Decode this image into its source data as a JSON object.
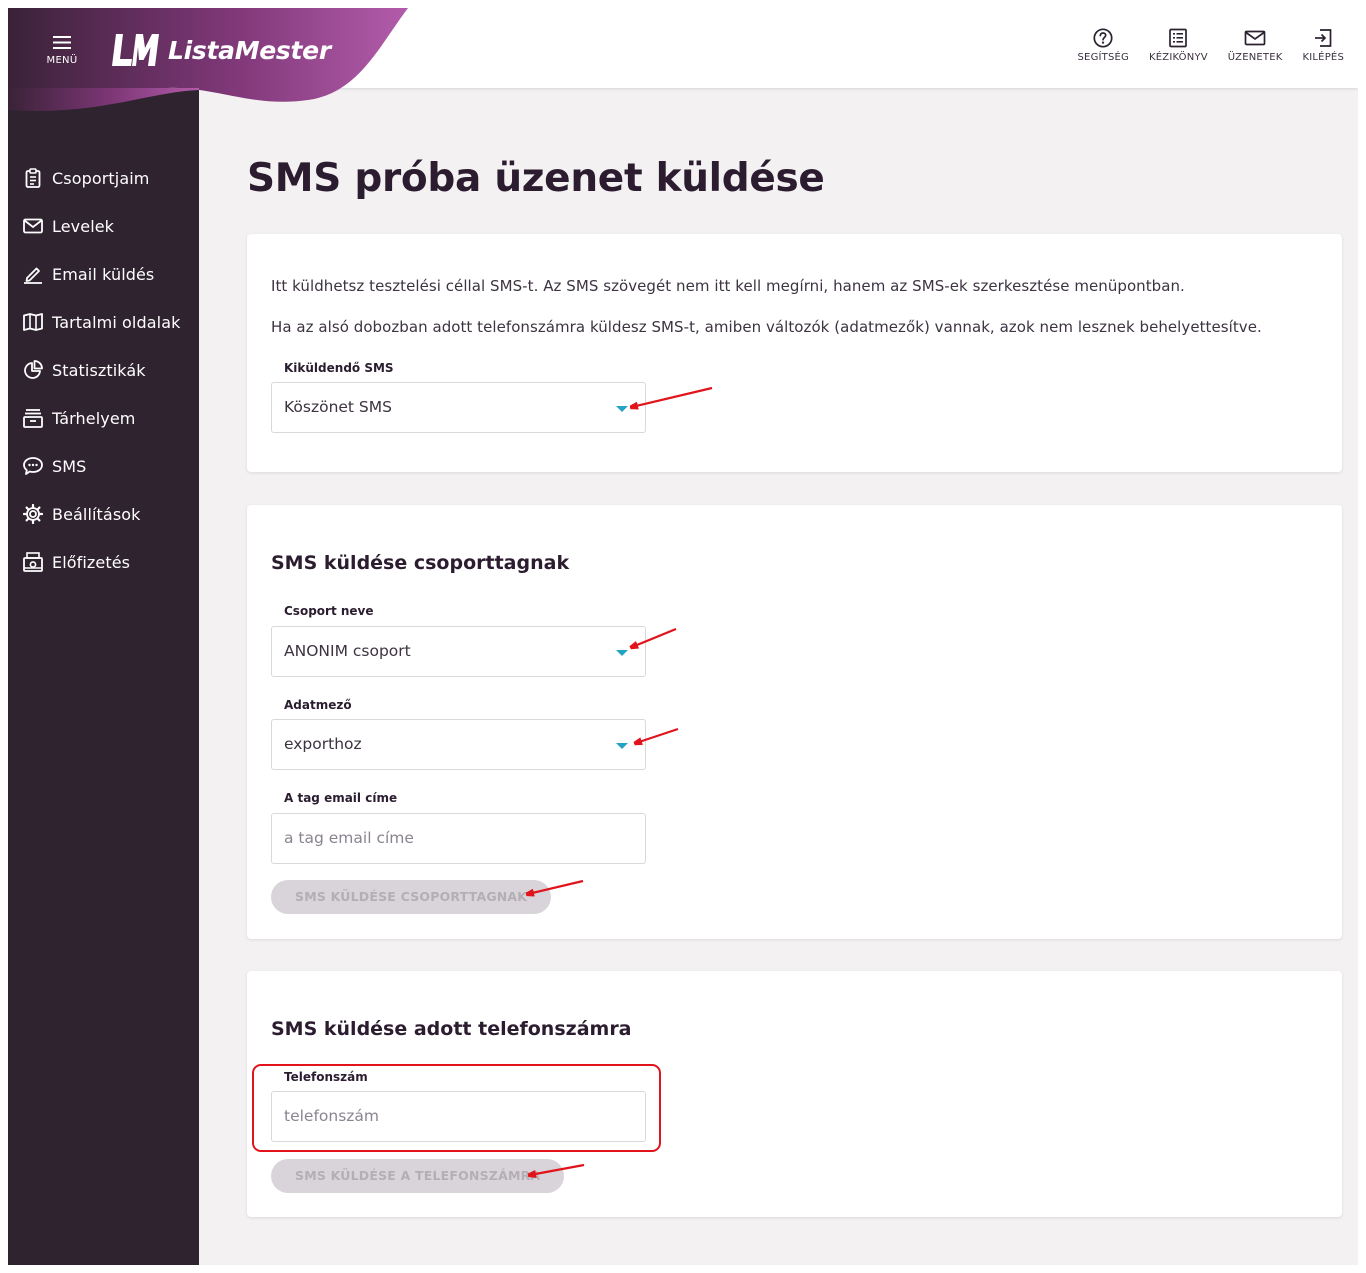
{
  "header": {
    "menu_label": "MENÜ",
    "brand": "ListaMester",
    "brand_gradient": [
      "#2f2330",
      "#8a3d86",
      "#b05aa8"
    ],
    "top_nav": [
      {
        "label": "SEGÍTSÉG",
        "icon": "help-circle-icon"
      },
      {
        "label": "KÉZIKÖNYV",
        "icon": "manual-list-icon"
      },
      {
        "label": "ÜZENETEK",
        "icon": "envelope-icon"
      },
      {
        "label": "KILÉPÉS",
        "icon": "logout-icon"
      }
    ]
  },
  "sidebar": {
    "items": [
      {
        "label": "Csoportjaim",
        "icon": "clipboard-icon"
      },
      {
        "label": "Levelek",
        "icon": "mail-icon"
      },
      {
        "label": "Email küldés",
        "icon": "pen-icon"
      },
      {
        "label": "Tartalmi oldalak",
        "icon": "book-icon"
      },
      {
        "label": "Statisztikák",
        "icon": "pie-chart-icon"
      },
      {
        "label": "Tárhelyem",
        "icon": "archive-icon"
      },
      {
        "label": "SMS",
        "icon": "chat-bubble-icon"
      },
      {
        "label": "Beállítások",
        "icon": "gear-icon"
      },
      {
        "label": "Előfizetés",
        "icon": "cash-register-icon"
      }
    ]
  },
  "main": {
    "title": "SMS próba üzenet küldése",
    "intro": {
      "line1": "Itt küldhetsz tesztelési céllal SMS-t. Az SMS szövegét nem itt kell megírni, hanem az SMS-ek szerkesztése menüpontban.",
      "line2": "Ha az alsó dobozban adott telefonszámra küldesz SMS-t, amiben változók (adatmezők) vannak, azok nem lesznek behelyettesítve.",
      "sms_label": "Kiküldendő SMS",
      "sms_value": "Köszönet SMS"
    },
    "group_section": {
      "title": "SMS küldése csoporttagnak",
      "group_label": "Csoport neve",
      "group_value": "ANONIM csoport",
      "field_label": "Adatmező",
      "field_value": "exporthoz",
      "email_label": "A tag email címe",
      "email_placeholder": "a tag email címe",
      "button": "SMS KÜLDÉSE CSOPORTTAGNAK"
    },
    "phone_section": {
      "title": "SMS küldése adott telefonszámra",
      "phone_label": "Telefonszám",
      "phone_placeholder": "telefonszám",
      "button": "SMS KÜLDÉSE A TELEFONSZÁMRA"
    }
  },
  "colors": {
    "sidebar_bg": "#2f2330",
    "page_bg": "#f4f1f3",
    "caret": "#25a3c3",
    "annotation_red": "#e1141c",
    "disabled_button_bg": "#d9d4d9"
  }
}
